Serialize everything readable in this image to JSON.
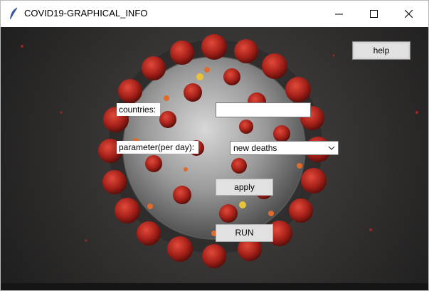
{
  "window": {
    "title": "COVID19-GRAPHICAL_INFO",
    "controls": {
      "minimize": "—",
      "maximize": "☐",
      "close": "✕"
    }
  },
  "form": {
    "countries_label": "countries:",
    "countries_value": "",
    "parameter_label": "parameter(per day):",
    "parameter_selected": "new deaths",
    "apply_label": "apply",
    "run_label": "RUN",
    "help_label": "help"
  },
  "colors": {
    "background": "#2b2a29",
    "virus_body": "#8c8c8c",
    "spike": "#b3261e",
    "accent_orange": "#e06a2a",
    "accent_yellow": "#e8c23a"
  },
  "icons": {
    "app": "feather-icon",
    "dropdown": "chevron-down-icon"
  }
}
